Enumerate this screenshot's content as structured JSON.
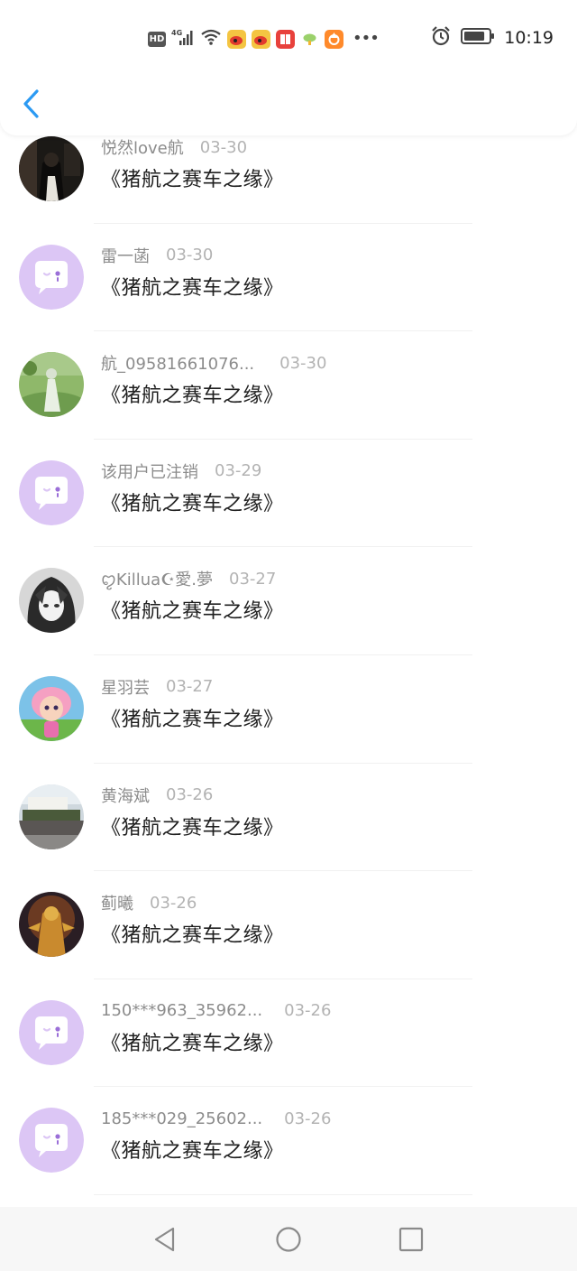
{
  "statusbar": {
    "hd": "HD",
    "network": "4G",
    "time": "10:19",
    "left_icons": [
      "hd-icon",
      "signal-icon",
      "wifi-icon",
      "weibo-icon",
      "weibo-icon",
      "book-app-icon",
      "cloud-app-icon",
      "orange-app-icon",
      "more-icon"
    ],
    "right_icons": [
      "alarm-icon",
      "battery-icon"
    ],
    "battery_level": 0.85
  },
  "header": {
    "back_icon": "chevron-left-icon",
    "accent_color": "#2b9af3"
  },
  "list": {
    "items": [
      {
        "username": "悦然love航",
        "date": "03-30",
        "content": "《猪航之赛车之缘》",
        "avatar": "photo-dark-figure"
      },
      {
        "username": "雷一菡",
        "date": "03-30",
        "content": "《猪航之赛车之缘》",
        "avatar": "default-chat-bubble"
      },
      {
        "username": "航_09581661076...",
        "date": "03-30",
        "content": "《猪航之赛车之缘》",
        "avatar": "photo-green-field"
      },
      {
        "username": "该用户已注销",
        "date": "03-29",
        "content": "《猪航之赛车之缘》",
        "avatar": "default-chat-bubble"
      },
      {
        "username": "ꨄKillua☪愛.夢",
        "date": "03-27",
        "content": "《猪航之赛车之缘》",
        "avatar": "photo-anime-bw"
      },
      {
        "username": "星羽芸",
        "date": "03-27",
        "content": "《猪航之赛车之缘》",
        "avatar": "photo-cartoon-girl"
      },
      {
        "username": "黄海斌",
        "date": "03-26",
        "content": "《猪航之赛车之缘》",
        "avatar": "photo-group-crowd"
      },
      {
        "username": "蓟曦",
        "date": "03-26",
        "content": "《猪航之赛车之缘》",
        "avatar": "photo-game-warrior"
      },
      {
        "username": "150***963_35962...",
        "date": "03-26",
        "content": "《猪航之赛车之缘》",
        "avatar": "default-chat-bubble"
      },
      {
        "username": "185***029_25602...",
        "date": "03-26",
        "content": "《猪航之赛车之缘》",
        "avatar": "default-chat-bubble"
      }
    ]
  },
  "navbar": {
    "icons": [
      "nav-back-triangle-icon",
      "nav-home-circle-icon",
      "nav-recents-square-icon"
    ]
  },
  "colors": {
    "default_avatar_bg": "#dcc6f5",
    "username": "#8c8c8c",
    "date": "#b3b3b3",
    "content": "#1f1f1f"
  }
}
